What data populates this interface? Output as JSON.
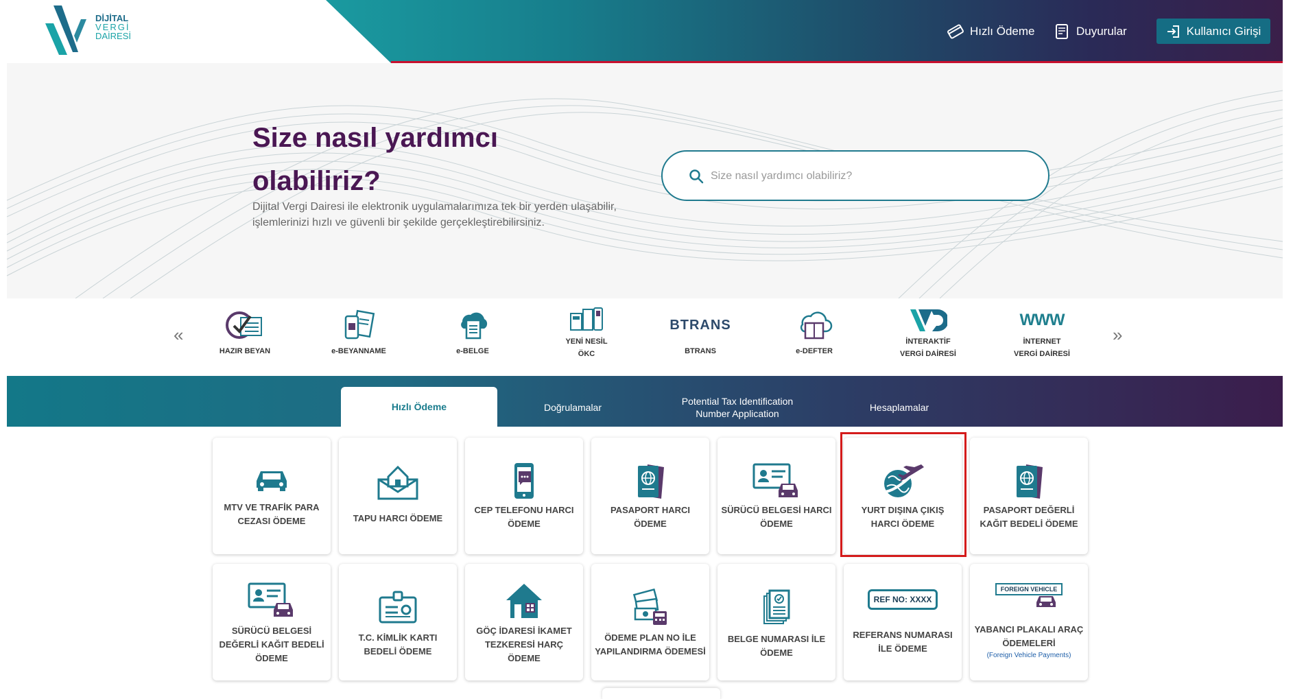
{
  "logo": {
    "line1": "DİJİTAL",
    "line2": "VERGİ",
    "line3": "DAİRESİ"
  },
  "header": {
    "hizli_odeme": "Hızlı Ödeme",
    "duyurular": "Duyurular",
    "login": "Kullanıcı Girişi"
  },
  "hero": {
    "title": "Size nasıl yardımcı olabiliriz?",
    "subtitle": "Dijital Vergi Dairesi ile elektronik uygulamalarımıza tek bir yerden ulaşabilir, işlemlerinizi hızlı ve güvenli bir şekilde gerçekleştirebilirsiniz.",
    "search_placeholder": "Size nasıl yardımcı olabiliriz?"
  },
  "carousel": {
    "prev": "«",
    "next": "»",
    "items": [
      {
        "label": "HAZIR BEYAN",
        "icon": "form-check-icon"
      },
      {
        "label": "e-BEYANNAME",
        "icon": "document-phone-icon"
      },
      {
        "label": "e-BELGE",
        "icon": "cloud-document-icon"
      },
      {
        "label_line1": "YENİ NESİL",
        "label_line2": "ÖKC",
        "icon": "cash-register-icon"
      },
      {
        "label": "BTRANS",
        "logo_text": "BTRANS",
        "icon": "btrans-logo"
      },
      {
        "label": "e-DEFTER",
        "icon": "cloud-book-icon"
      },
      {
        "label_line1": "İNTERAKTİF",
        "label_line2": "VERGİ DAİRESİ",
        "icon": "vd-logo"
      },
      {
        "label_line1": "İNTERNET",
        "label_line2": "VERGİ DAİRESİ",
        "logo_text": "WWW",
        "icon": "www-logo"
      }
    ]
  },
  "tabs": [
    {
      "label": "Hızlı Ödeme",
      "active": true
    },
    {
      "label": "Doğrulamalar",
      "active": false
    },
    {
      "label_line1": "Potential Tax Identification",
      "label_line2": "Number Application",
      "active": false
    },
    {
      "label": "Hesaplamalar",
      "active": false
    }
  ],
  "cards": [
    {
      "label": "MTV VE TRAFİK PARA CEZASI ÖDEME",
      "icon": "car-icon"
    },
    {
      "label": "TAPU HARCI ÖDEME",
      "icon": "house-envelope-icon"
    },
    {
      "label": "CEP TELEFONU HARCI ÖDEME",
      "icon": "mobile-phone-icon"
    },
    {
      "label": "PASAPORT HARCI ÖDEME",
      "icon": "passport-icon"
    },
    {
      "label": "SÜRÜCÜ BELGESİ HARCI ÖDEME",
      "icon": "license-car-icon"
    },
    {
      "label": "YURT DIŞINA ÇIKIŞ HARCI ÖDEME",
      "icon": "globe-plane-icon"
    },
    {
      "label": "PASAPORT DEĞERLİ KAĞIT BEDELİ ÖDEME",
      "icon": "passport-icon"
    },
    {
      "label": "SÜRÜCÜ BELGESİ DEĞERLİ KAĞIT BEDELİ ÖDEME",
      "icon": "license-car-icon"
    },
    {
      "label": "T.C. KİMLİK KARTI BEDELİ ÖDEME",
      "icon": "id-card-icon"
    },
    {
      "label": "GÖÇ İDARESİ İKAMET TEZKERESİ HARÇ ÖDEME",
      "icon": "house-building-icon"
    },
    {
      "label": "ÖDEME PLAN NO İLE YAPILANDIRMA ÖDEMESİ",
      "icon": "money-calculator-icon"
    },
    {
      "label": "BELGE NUMARASI İLE ÖDEME",
      "icon": "document-stack-icon"
    },
    {
      "label": "REFERANS NUMARASI İLE ÖDEME",
      "icon": "ref-no-icon",
      "icon_text": "REF NO: XXXX"
    },
    {
      "label": "YABANCI PLAKALI ARAÇ ÖDEMELERİ",
      "sub": "(Foreign Vehicle Payments)",
      "icon": "foreign-vehicle-icon",
      "icon_text": "FOREIGN VEHICLE"
    }
  ],
  "colors": {
    "teal": "#1a7c8d",
    "purple": "#4a1753",
    "highlight_red": "#d41b1b",
    "header_red": "#c8102e"
  }
}
